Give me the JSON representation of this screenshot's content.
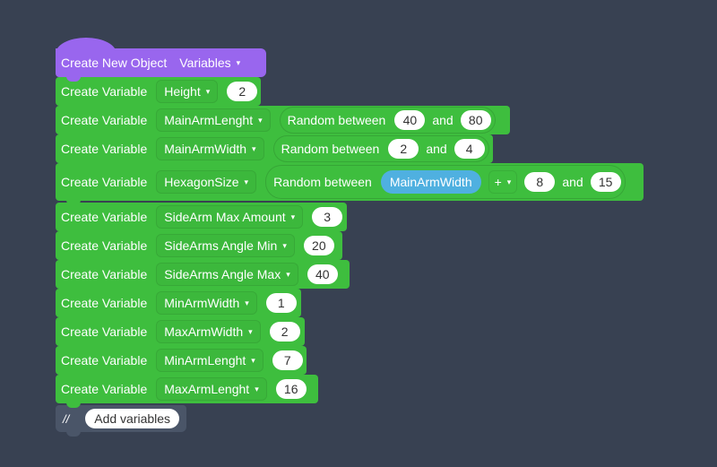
{
  "colors": {
    "background": "#384152",
    "event_block": "#9966ee",
    "variable_block": "#3ebe3e",
    "variable_reporter": "#4fb0e0",
    "comment_block": "#4a5568"
  },
  "hat_block": {
    "label": "Create New Object",
    "dropdown": "Variables",
    "caret_icon": "▾"
  },
  "blocks": [
    {
      "label": "Create Variable",
      "variable": "Height",
      "value": "2"
    },
    {
      "label": "Create Variable",
      "variable": "MainArmLenght",
      "random": {
        "label": "Random between",
        "min": "40",
        "and": "and",
        "max": "80"
      }
    },
    {
      "label": "Create Variable",
      "variable": "MainArmWidth",
      "random": {
        "label": "Random between",
        "min": "2",
        "and": "and",
        "max": "4"
      }
    },
    {
      "label": "Create Variable",
      "variable": "HexagonSize",
      "random": {
        "label": "Random between",
        "min_var": "MainArmWidth",
        "operator": "+",
        "operand": "8",
        "and": "and",
        "max": "15"
      }
    },
    {
      "label": "Create Variable",
      "variable": "SideArm Max Amount",
      "value": "3"
    },
    {
      "label": "Create Variable",
      "variable": "SideArms Angle Min",
      "value": "20"
    },
    {
      "label": "Create Variable",
      "variable": "SideArms Angle Max",
      "value": "40"
    },
    {
      "label": "Create Variable",
      "variable": "MinArmWidth",
      "value": "1"
    },
    {
      "label": "Create Variable",
      "variable": "MaxArmWidth",
      "value": "2"
    },
    {
      "label": "Create Variable",
      "variable": "MinArmLenght",
      "value": "7"
    },
    {
      "label": "Create Variable",
      "variable": "MaxArmLenght",
      "value": "16"
    }
  ],
  "comment": {
    "prefix": "//",
    "text": "Add variables"
  }
}
